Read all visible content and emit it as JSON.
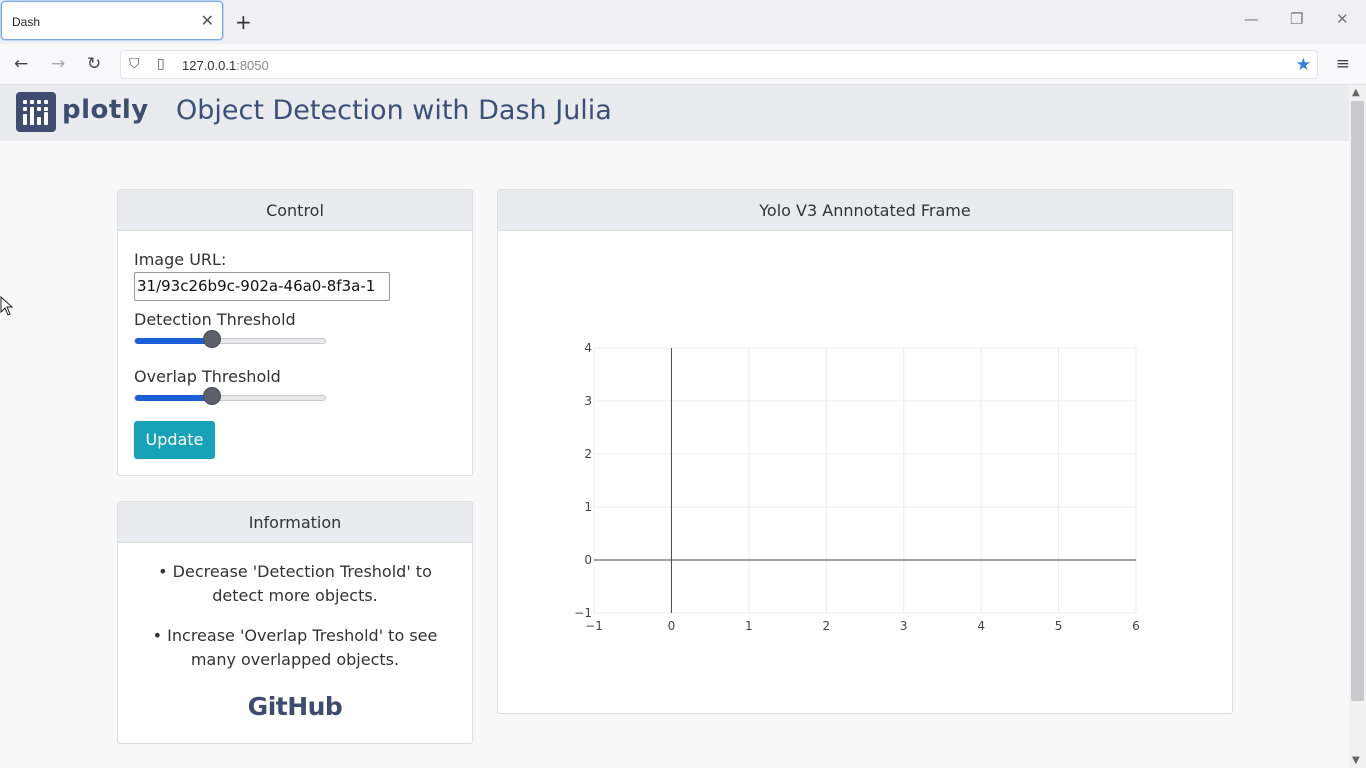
{
  "browser": {
    "tab_title": "Dash",
    "url_host": "127.0.0.1",
    "url_port": ":8050"
  },
  "header": {
    "logo_text": "plotly",
    "title": "Object Detection with Dash Julia"
  },
  "control": {
    "title": "Control",
    "image_url_label": "Image URL:",
    "image_url_value": "31/93c26b9c-902a-46a0-8f3a-1",
    "detection_label": "Detection Threshold",
    "detection_value": 0.4,
    "overlap_label": "Overlap Threshold",
    "overlap_value": 0.4,
    "update_label": "Update"
  },
  "information": {
    "title": "Information",
    "items": [
      "• Decrease 'Detection Treshold' to detect more objects.",
      "• Increase 'Overlap Treshold' to see many overlapped objects."
    ],
    "github_label": "GitHub"
  },
  "plot_card": {
    "title": "Yolo V3 Annnotated Frame"
  },
  "chart_data": {
    "type": "scatter",
    "x": [],
    "y": [],
    "xlim": [
      -1,
      6
    ],
    "ylim": [
      -1,
      4
    ],
    "xticks": [
      "−1",
      "0",
      "1",
      "2",
      "3",
      "4",
      "5",
      "6"
    ],
    "yticks": [
      "−1",
      "0",
      "1",
      "2",
      "3",
      "4"
    ],
    "grid": true
  }
}
